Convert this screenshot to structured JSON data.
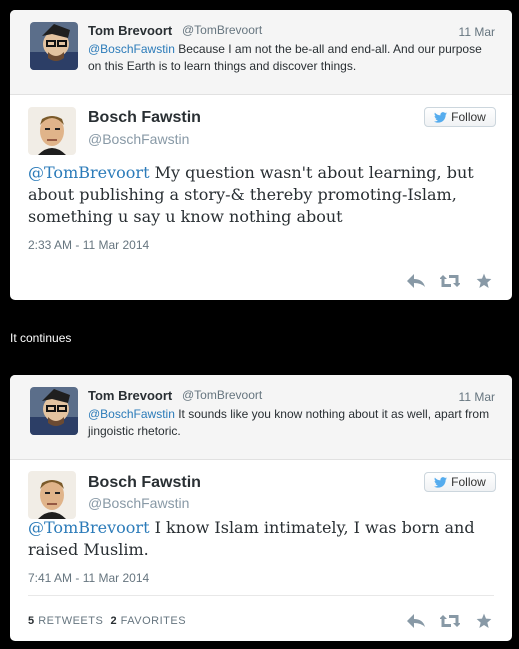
{
  "cards": [
    {
      "reply": {
        "name": "Tom Brevoort",
        "handle": "@TomBrevoort",
        "date": "11 Mar",
        "mention": "@BoschFawstin",
        "text": " Because I am not the be-all and end-all. And our purpose on this Earth is to learn things and discover things."
      },
      "main": {
        "name": "Bosch Fawstin",
        "handle": "@BoschFawstin",
        "follow_label": "Follow",
        "mention": "@TomBrevoort",
        "text": " My question wasn't about learning, but about publishing a story-& thereby promoting-Islam, something u say u know nothing about",
        "timestamp": "2:33 AM - 11 Mar 2014"
      }
    },
    {
      "reply": {
        "name": "Tom Brevoort",
        "handle": "@TomBrevoort",
        "date": "11 Mar",
        "mention": "@BoschFawstin",
        "text": " It sounds like you know nothing about it as well, apart from jingoistic rhetoric."
      },
      "main": {
        "name": "Bosch Fawstin",
        "handle": "@BoschFawstin",
        "follow_label": "Follow",
        "mention": "@TomBrevoort",
        "text": " I know Islam intimately, I was born and raised Muslim.",
        "timestamp": "7:41 AM - 11 Mar 2014",
        "retweets_count": "5",
        "retweets_label": "RETWEETS",
        "favorites_count": "2",
        "favorites_label": "FAVORITES"
      }
    }
  ],
  "caption": "It continues",
  "colors": {
    "link": "#2b7bb9",
    "bird": "#55acee",
    "icon": "#8899a6"
  },
  "icons": [
    "reply-icon",
    "retweet-icon",
    "favorite-icon",
    "twitter-bird-icon"
  ]
}
